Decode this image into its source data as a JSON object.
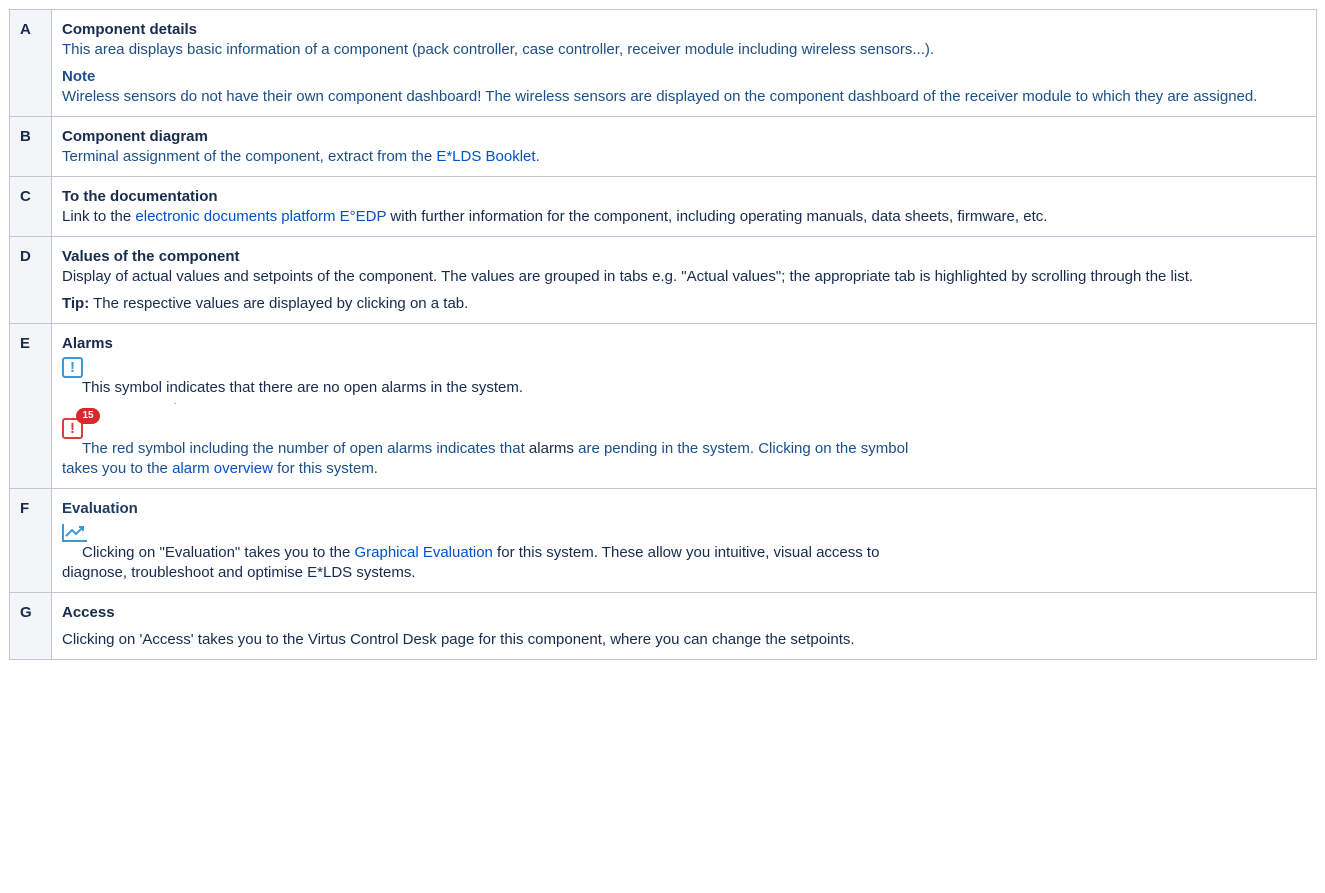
{
  "rows": [
    {
      "key": "A",
      "title": "Component details",
      "text": "This area displays basic information of a component (pack controller, case controller, receiver module including wireless sensors...).",
      "note_title": "Note",
      "note_text": "Wireless sensors do not have their own component dashboard! The wireless sensors are displayed on the component dashboard of the receiver module to which they are assigned."
    },
    {
      "key": "B",
      "title": "Component diagram",
      "text_before": "Terminal assignment of the component, extract from the ",
      "link": "E*LDS Booklet",
      "text_after": "."
    },
    {
      "key": "C",
      "title": "To the documentation",
      "text_before": "Link to the ",
      "link": "electronic documents platform E°EDP",
      "text_after": " with further information for the component, including operating manuals, data sheets, firmware, etc."
    },
    {
      "key": "D",
      "title": "Values of the component",
      "text": "Display of actual values and setpoints of the component. The values are grouped in tabs e.g. \"Actual values\"; the appropriate tab is highlighted by scrolling through the list.",
      "tip_label": "Tip:",
      "tip_text": " The respective values are displayed by clicking on a tab."
    },
    {
      "key": "E",
      "title": "Alarms",
      "icon_symbol": "!",
      "no_alarm_text": "This symbol indicates that there are no open alarms in the system.",
      "tiny_dot": ".",
      "badge_count": "15",
      "red_text_a": "The red symbol including the number of open alarms indicates that ",
      "red_text_b": "alarms",
      "red_text_c": " are pending in the system. Clicking on the symbol",
      "red_text_d": "takes you to the ",
      "link": "alarm overview",
      "red_text_e": " for this system."
    },
    {
      "key": "F",
      "title": "Evaluation",
      "text_before": "Clicking on \"Evaluation\" takes you to the ",
      "link": "Graphical Evaluation",
      "text_after": " for this system. These allow you intuitive, visual access to",
      "text_line2": "diagnose, troubleshoot and optimise E*LDS systems."
    },
    {
      "key": "G",
      "title": "Access",
      "text": "Clicking on 'Access' takes you to the Virtus Control Desk page for this component, where you can change the setpoints."
    }
  ],
  "colors": {
    "link": "#0052cc",
    "alarm_blue": "#3a9ad9",
    "alarm_red": "#e03c3c",
    "key_bg": "#f4f5f7"
  }
}
